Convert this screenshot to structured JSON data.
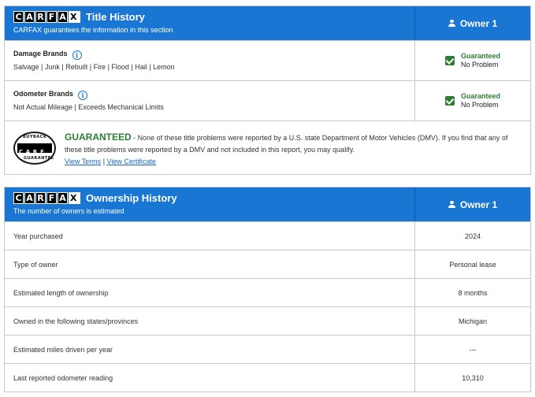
{
  "logo": {
    "letters": [
      "C",
      "A",
      "R",
      "F",
      "A"
    ]
  },
  "title_history": {
    "title": "Title History",
    "subtitle": "CARFAX guarantees the information in this section",
    "owner_header": "Owner 1",
    "rows": [
      {
        "title": "Damage Brands",
        "list": "Salvage | Junk | Rebuilt | Fire | Flood | Hail | Lemon",
        "status": "Guaranteed",
        "result": "No Problem"
      },
      {
        "title": "Odometer Brands",
        "list": "Not Actual Mileage | Exceeds Mechanical Limits",
        "status": "Guaranteed",
        "result": "No Problem"
      }
    ],
    "guarantee": {
      "seal_top": "BUYBACK",
      "seal_bottom": "GUARANTEE",
      "word": "GUARANTEED",
      "text": " - None of these title problems were reported by a U.S. state Department of Motor Vehicles (DMV). If you find that any of these title problems were reported by a DMV and not included in this report, you may qualify.",
      "view_terms": "View Terms",
      "separator": " | ",
      "view_certificate": "View Certificate"
    }
  },
  "ownership_history": {
    "title": "Ownership History",
    "subtitle": "The number of owners is estimated",
    "owner_header": "Owner 1",
    "rows": [
      {
        "label": "Year purchased",
        "value": "2024"
      },
      {
        "label": "Type of owner",
        "value": "Personal lease"
      },
      {
        "label": "Estimated length of ownership",
        "value": "8 months"
      },
      {
        "label": "Owned in the following states/provinces",
        "value": "Michigan"
      },
      {
        "label": "Estimated miles driven per year",
        "value": "---"
      },
      {
        "label": "Last reported odometer reading",
        "value": "10,310"
      }
    ]
  },
  "colors": {
    "header_blue": "#1976d2",
    "guarantee_green": "#2e7d32",
    "link_blue": "#1565c0",
    "border": "#c8c8c8"
  }
}
